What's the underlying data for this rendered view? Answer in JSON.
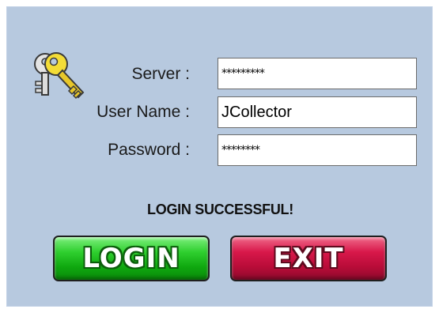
{
  "login_form": {
    "icon": "keys-icon",
    "server": {
      "label": "Server :",
      "value": "*********"
    },
    "username": {
      "label": "User Name :",
      "value": "JCollector"
    },
    "password": {
      "label": "Password :",
      "value": "********"
    },
    "status_message": "LOGIN SUCCESSFUL!",
    "login_button": "LOGIN",
    "exit_button": "EXIT"
  },
  "colors": {
    "panel_background": "#b7c9df",
    "login_button": "#1fbf1f",
    "exit_button": "#c8103e"
  }
}
